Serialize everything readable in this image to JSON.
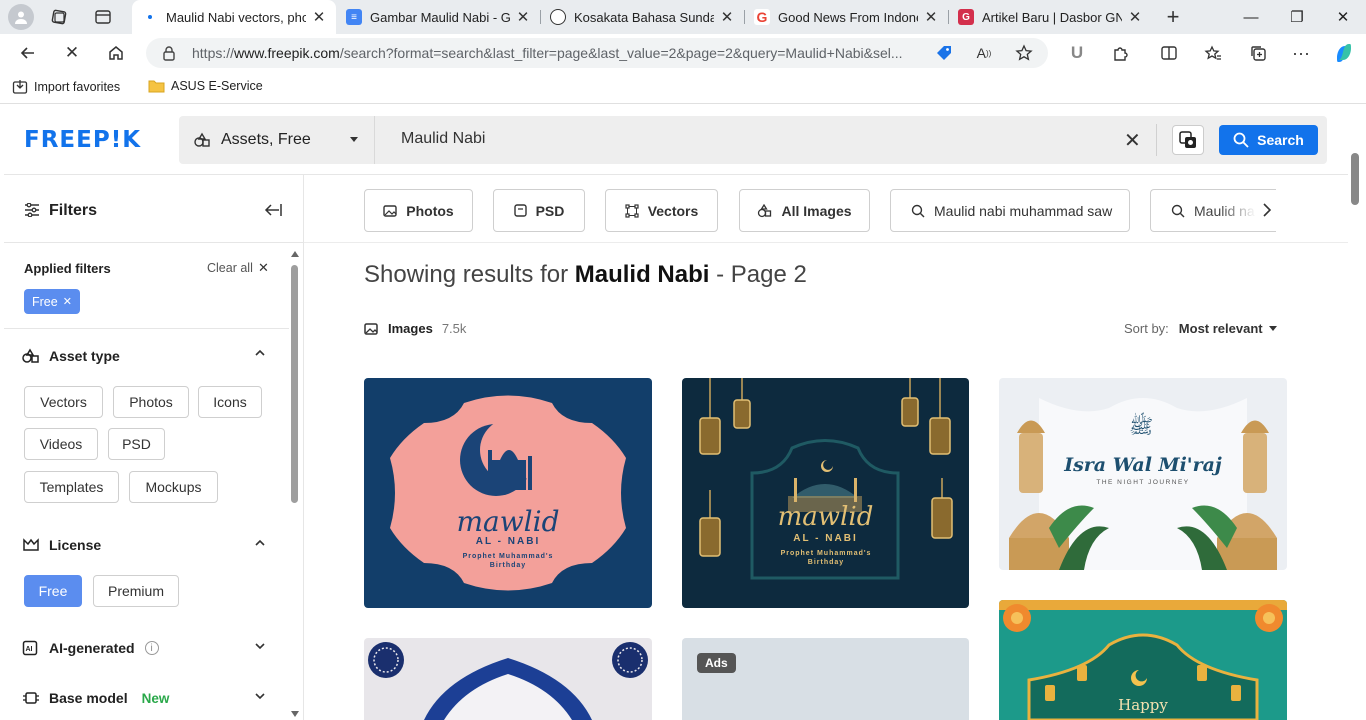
{
  "browser": {
    "tabs": [
      {
        "label": "Maulid Nabi vectors, photo",
        "favicon": "freepik-icon",
        "active": true
      },
      {
        "label": "Gambar Maulid Nabi - Goo",
        "favicon": "docs-icon",
        "active": false
      },
      {
        "label": "Kosakata Bahasa Sunda",
        "favicon": "chatgpt-icon",
        "active": false
      },
      {
        "label": "Good News From Indonesi",
        "favicon": "google-icon",
        "active": false
      },
      {
        "label": "Artikel Baru | Dasbor GNFI",
        "favicon": "gnfi-icon",
        "active": false
      }
    ],
    "url_prefix": "https://",
    "url_domain": "www.freepik.com",
    "url_rest": "/search?format=search&last_filter=page&last_value=2&page=2&query=Maulid+Nabi&sel...",
    "bookmarks": [
      {
        "label": "Import favorites",
        "icon": "import-icon"
      },
      {
        "label": "ASUS E-Service",
        "icon": "folder-icon"
      }
    ]
  },
  "header": {
    "logo": "FREEP!K",
    "asset_selector": "Assets, Free",
    "search_query": "Maulid Nabi",
    "search_button": "Search"
  },
  "sidebar": {
    "title": "Filters",
    "applied_filters_label": "Applied filters",
    "clear_all": "Clear all",
    "applied_chip": "Free",
    "asset_type": {
      "label": "Asset type",
      "options": [
        "Vectors",
        "Photos",
        "Icons",
        "Videos",
        "PSD",
        "Templates",
        "Mockups"
      ]
    },
    "license": {
      "label": "License",
      "options": [
        "Free",
        "Premium"
      ],
      "selected": "Free"
    },
    "ai_generated": {
      "label": "AI-generated"
    },
    "base_model": {
      "label": "Base model",
      "badge": "New"
    }
  },
  "main": {
    "pills": [
      "Photos",
      "PSD",
      "Vectors",
      "All Images"
    ],
    "suggestions": [
      "Maulid nabi muhammad saw",
      "Maulid na"
    ],
    "results_prefix": "Showing results for",
    "results_query": "Maulid Nabi",
    "results_suffix": "- Page 2",
    "images_label": "Images",
    "images_count": "7.5k",
    "sort_label": "Sort by:",
    "sort_value": "Most relevant",
    "ads_badge": "Ads",
    "card1": {
      "title": "mawlid",
      "sub": "AL - NABI",
      "small": "Prophet Muhammad's Birthday"
    },
    "card2": {
      "title": "mawlid",
      "sub": "AL - NABI",
      "small": "Prophet Muhammad's Birthday"
    },
    "card3": {
      "title": "Isra Wal Mi'raj",
      "sub": "THE NIGHT JOURNEY"
    },
    "card6": {
      "title": "Happy"
    }
  },
  "colors": {
    "accent": "#1273eb",
    "chip_blue": "#5b8def",
    "new_badge": "#2aa84a"
  }
}
